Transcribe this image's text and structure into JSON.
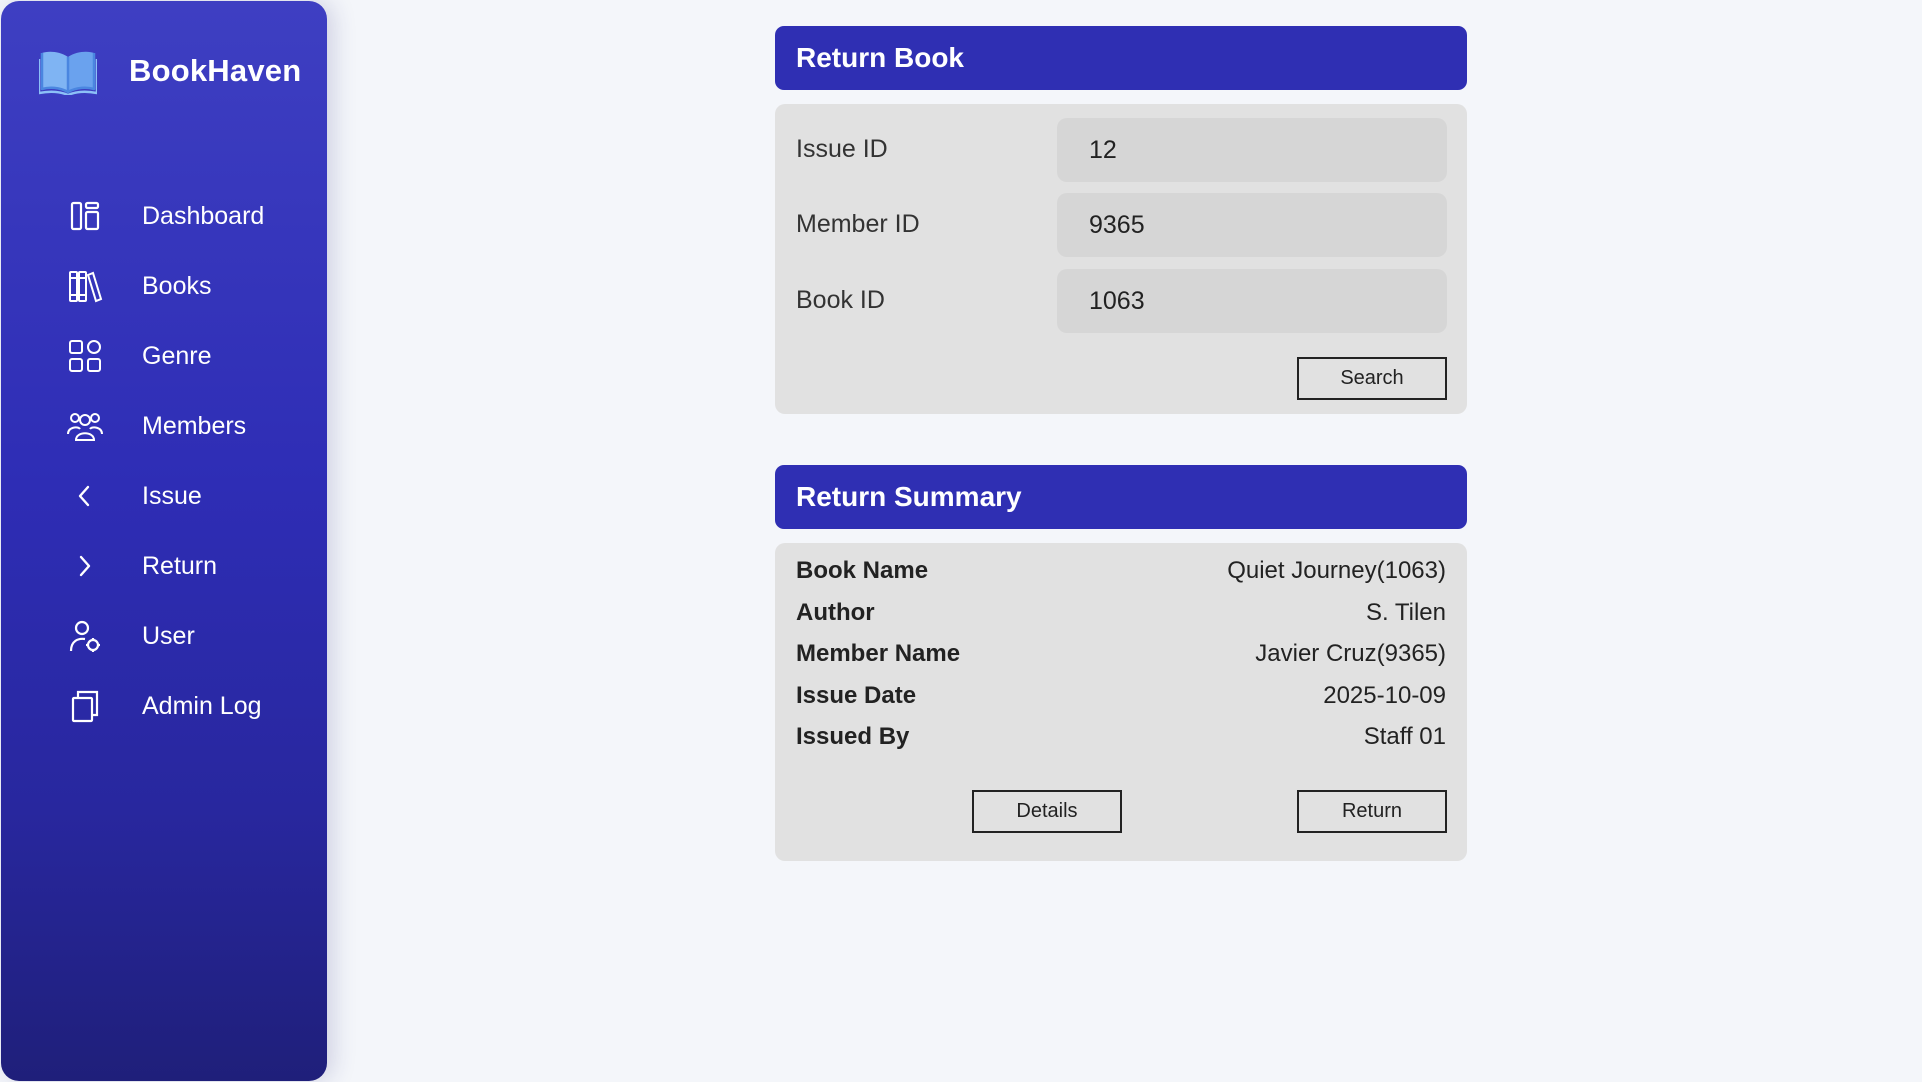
{
  "brand": {
    "name": "BookHaven"
  },
  "nav": [
    {
      "label": "Dashboard",
      "icon": "dashboard-icon"
    },
    {
      "label": "Books",
      "icon": "books-icon"
    },
    {
      "label": "Genre",
      "icon": "genre-grid-icon"
    },
    {
      "label": "Members",
      "icon": "members-icon"
    },
    {
      "label": "Issue",
      "icon": "chevron-left-icon"
    },
    {
      "label": "Return",
      "icon": "chevron-right-icon"
    },
    {
      "label": "User",
      "icon": "user-icon"
    },
    {
      "label": "Admin Log",
      "icon": "copy-icon"
    }
  ],
  "return_book": {
    "title": "Return Book",
    "fields": [
      {
        "label": "Issue ID",
        "value": "12"
      },
      {
        "label": "Member ID",
        "value": "9365"
      },
      {
        "label": "Book ID",
        "value": "1063"
      }
    ],
    "search_label": "Search"
  },
  "summary": {
    "title": "Return Summary",
    "rows": [
      {
        "key": "Book Name",
        "value": "Quiet Journey(1063)"
      },
      {
        "key": "Author",
        "value": "S. Tilen"
      },
      {
        "key": "Member Name",
        "value": "Javier Cruz(9365)"
      },
      {
        "key": "Issue Date",
        "value": "2025-10-09"
      },
      {
        "key": "Issued By",
        "value": "Staff 01"
      }
    ],
    "details_label": "Details",
    "return_label": "Return"
  },
  "colors": {
    "sidebar_top": "#3e3fc2",
    "sidebar_bottom": "#1f1f7a",
    "header": "#2f2fb3",
    "card_body": "#e1e1e1",
    "input_bg": "#d6d6d6",
    "page_bg": "#f4f6fa"
  }
}
